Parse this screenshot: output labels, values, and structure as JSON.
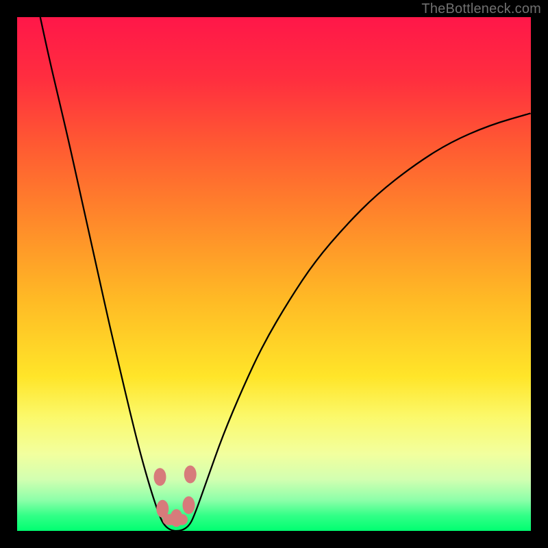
{
  "watermark": "TheBottleneck.com",
  "colors": {
    "bg": "#000000",
    "marker": "#d77b7b",
    "curve": "#000000",
    "watermark": "#707070"
  },
  "chart_data": {
    "type": "line",
    "title": "",
    "xlabel": "",
    "ylabel": "",
    "xlim": [
      0,
      100
    ],
    "ylim": [
      0,
      100
    ],
    "gradient_stops": [
      {
        "offset": 0.0,
        "color": "#ff1749"
      },
      {
        "offset": 0.12,
        "color": "#ff2e3f"
      },
      {
        "offset": 0.25,
        "color": "#ff5a32"
      },
      {
        "offset": 0.4,
        "color": "#ff8a2a"
      },
      {
        "offset": 0.55,
        "color": "#ffba25"
      },
      {
        "offset": 0.7,
        "color": "#ffe529"
      },
      {
        "offset": 0.78,
        "color": "#fbf96c"
      },
      {
        "offset": 0.85,
        "color": "#f2ff9e"
      },
      {
        "offset": 0.9,
        "color": "#d2ffb1"
      },
      {
        "offset": 0.94,
        "color": "#8dffa9"
      },
      {
        "offset": 0.97,
        "color": "#33ff87"
      },
      {
        "offset": 1.0,
        "color": "#00ff71"
      }
    ],
    "series": [
      {
        "name": "bottleneck-curve",
        "points": [
          {
            "x": 4.5,
            "y": 100.0
          },
          {
            "x": 6.0,
            "y": 93.0
          },
          {
            "x": 8.0,
            "y": 84.5
          },
          {
            "x": 10.0,
            "y": 76.0
          },
          {
            "x": 12.0,
            "y": 67.0
          },
          {
            "x": 14.0,
            "y": 58.0
          },
          {
            "x": 16.0,
            "y": 49.0
          },
          {
            "x": 18.0,
            "y": 40.0
          },
          {
            "x": 20.0,
            "y": 31.5
          },
          {
            "x": 22.0,
            "y": 23.0
          },
          {
            "x": 24.0,
            "y": 15.0
          },
          {
            "x": 26.0,
            "y": 8.0
          },
          {
            "x": 27.5,
            "y": 3.5
          },
          {
            "x": 28.5,
            "y": 1.2
          },
          {
            "x": 30.0,
            "y": 0.0
          },
          {
            "x": 32.0,
            "y": 0.0
          },
          {
            "x": 33.5,
            "y": 1.0
          },
          {
            "x": 34.5,
            "y": 3.0
          },
          {
            "x": 37.0,
            "y": 10.0
          },
          {
            "x": 40.0,
            "y": 18.5
          },
          {
            "x": 44.0,
            "y": 28.0
          },
          {
            "x": 48.0,
            "y": 36.5
          },
          {
            "x": 53.0,
            "y": 45.0
          },
          {
            "x": 58.0,
            "y": 52.5
          },
          {
            "x": 64.0,
            "y": 59.5
          },
          {
            "x": 70.0,
            "y": 65.5
          },
          {
            "x": 77.0,
            "y": 71.0
          },
          {
            "x": 84.0,
            "y": 75.5
          },
          {
            "x": 92.0,
            "y": 79.0
          },
          {
            "x": 100.0,
            "y": 81.3
          }
        ]
      }
    ],
    "markers": [
      {
        "name": "left-marker-top",
        "x": 27.8,
        "y": 10.5
      },
      {
        "name": "left-marker-bottom",
        "x": 28.3,
        "y": 4.3
      },
      {
        "name": "mid-marker-low",
        "x": 31.0,
        "y": 2.5
      },
      {
        "name": "right-marker-top",
        "x": 33.7,
        "y": 11.0
      },
      {
        "name": "right-marker-low",
        "x": 33.4,
        "y": 5.0
      }
    ]
  }
}
